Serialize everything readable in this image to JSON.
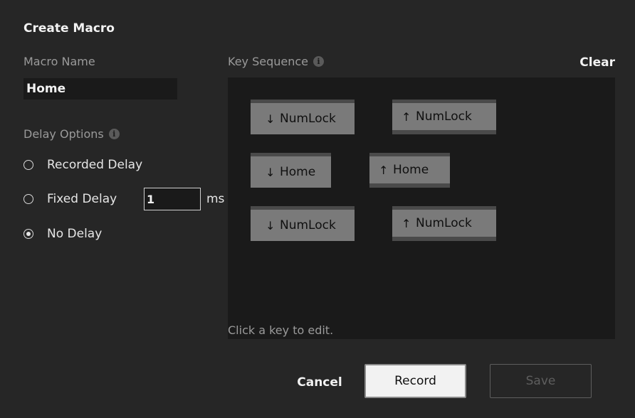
{
  "dialog": {
    "title": "Create Macro"
  },
  "macro_name": {
    "label": "Macro Name",
    "value": "Home"
  },
  "delay_options": {
    "label": "Delay Options",
    "info_icon": "info-icon",
    "options": [
      {
        "label": "Recorded Delay",
        "selected": false
      },
      {
        "label": "Fixed Delay",
        "selected": false
      },
      {
        "label": "No Delay",
        "selected": true
      }
    ],
    "fixed_delay_value": "1",
    "unit": "ms"
  },
  "key_sequence": {
    "label": "Key Sequence",
    "info_icon": "info-icon",
    "clear_label": "Clear",
    "hint": "Click a key to edit.",
    "keys": [
      {
        "arrow": "↓",
        "key": "NumLock",
        "action": "press"
      },
      {
        "arrow": "↑",
        "key": "NumLock",
        "action": "release"
      },
      {
        "arrow": "↓",
        "key": "Home",
        "action": "press"
      },
      {
        "arrow": "↑",
        "key": "Home",
        "action": "release"
      },
      {
        "arrow": "↓",
        "key": "NumLock",
        "action": "press"
      },
      {
        "arrow": "↑",
        "key": "NumLock",
        "action": "release"
      }
    ]
  },
  "actions": {
    "cancel_label": "Cancel",
    "record_label": "Record",
    "save_label": "Save"
  }
}
